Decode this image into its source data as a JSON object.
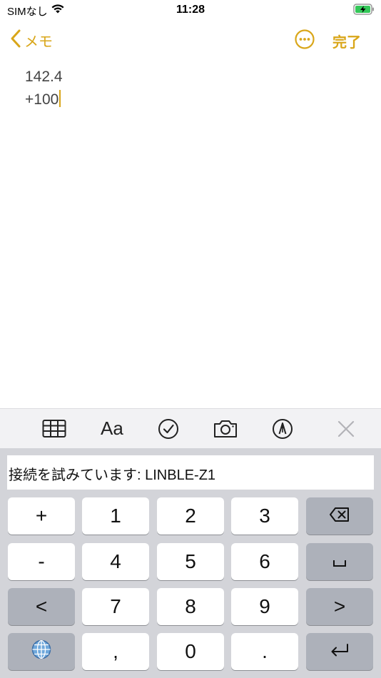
{
  "status_bar": {
    "carrier": "SIMなし",
    "time": "11:28"
  },
  "nav": {
    "back_label": "メモ",
    "done_label": "完了"
  },
  "note": {
    "lines": [
      "142.4",
      "+100"
    ]
  },
  "toolbar": {
    "text_style_label": "Aa"
  },
  "keyboard": {
    "message": "接続を試みています: LINBLE-Z1",
    "keys": {
      "plus": "+",
      "one": "1",
      "two": "2",
      "three": "3",
      "minus": "-",
      "four": "4",
      "five": "5",
      "six": "6",
      "less_than": "<",
      "seven": "7",
      "eight": "8",
      "nine": "9",
      "greater_than": ">",
      "comma": ",",
      "zero": "0",
      "period": "."
    }
  },
  "colors": {
    "accent": "#D9A619",
    "keyboard_bg": "#d3d4d9",
    "key_dark": "#adb1ba"
  }
}
